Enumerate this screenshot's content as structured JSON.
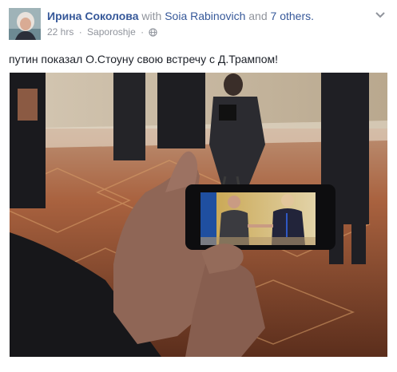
{
  "post": {
    "author_name": "Ирина Соколова",
    "with_text": "with",
    "tagged_person": "Soia Rabinovich",
    "and_text": "and",
    "others_text": "7 others.",
    "time": "22 hrs",
    "separator": "·",
    "location": "Saporoshje",
    "separator2": "·",
    "privacy_icon": "globe-icon",
    "menu_icon": "chevron-down-icon",
    "text": "путин показал О.Стоуну свою встречу с Д.Трампом!"
  },
  "colors": {
    "link": "#365899",
    "muted": "#90949c",
    "text": "#1d2129"
  }
}
